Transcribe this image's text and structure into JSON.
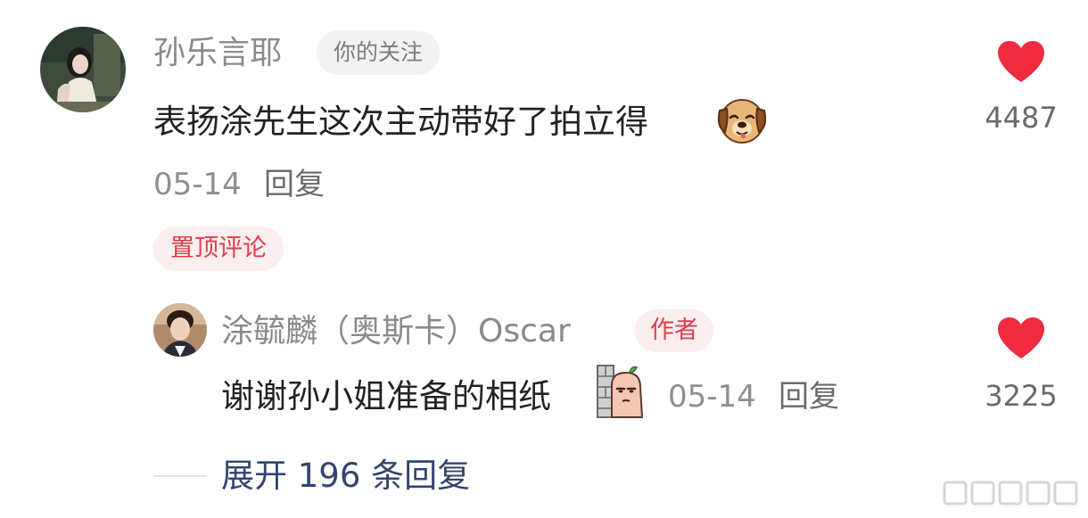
{
  "comment": {
    "username": "孙乐言耶",
    "follow_tag": "你的关注",
    "text": "表扬涂先生这次主动带好了拍立得",
    "emoji": "dog-emoji",
    "date": "05-14",
    "reply_label": "回复",
    "pinned_label": "置顶评论",
    "like_count": "4487",
    "like_icon": "heart-icon",
    "like_color": "#f02a3f"
  },
  "reply": {
    "username": "涂毓麟（奥斯卡）Oscar",
    "author_tag": "作者",
    "text": "谢谢孙小姐准备的相纸",
    "emoji": "peeking-wall-emoji",
    "date": "05-14",
    "reply_label": "回复",
    "like_count": "3225",
    "like_icon": "heart-icon",
    "like_color": "#f02a3f"
  },
  "expand": {
    "label": "展开 196 条回复"
  },
  "colors": {
    "accent_red": "#e03e4e",
    "link_blue": "#33456e"
  }
}
